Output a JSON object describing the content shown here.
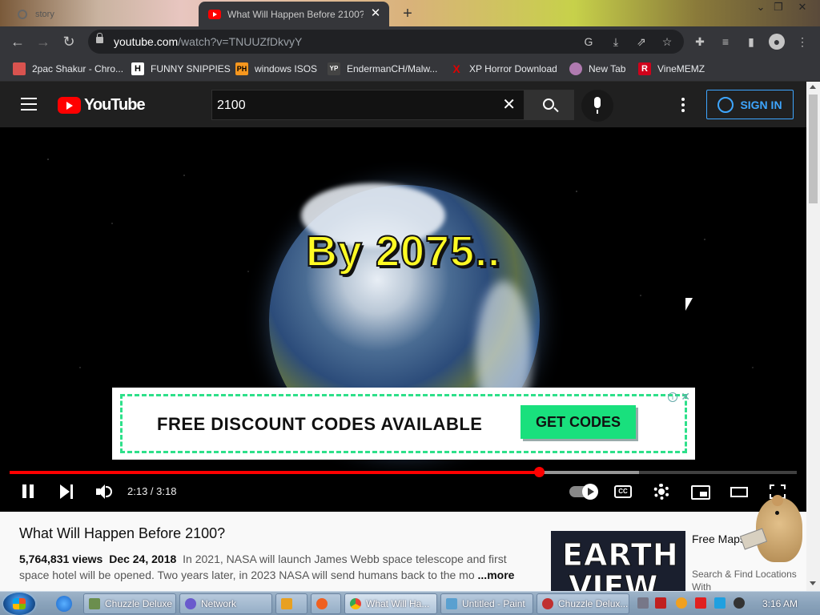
{
  "browser": {
    "prev_tab_label": "story",
    "active_tab_title": "What Will Happen Before 2100?",
    "url_host": "youtube.com",
    "url_path": "/watch?v=TNUUZfDkvyY",
    "new_tab_symbol": "+",
    "close_symbol": "✕"
  },
  "bookmarks": [
    {
      "label": "2pac Shakur - Chro...",
      "icon": "paint-icon",
      "badge": "",
      "color": "#d9534f"
    },
    {
      "label": "FUNNY SNIPPIES",
      "icon": "h-icon",
      "badge": "H",
      "color": "#ffffff"
    },
    {
      "label": "windows ISOS",
      "icon": "ph-icon",
      "badge": "PH",
      "color": "#f7971e"
    },
    {
      "label": "EndermanCH/Malw...",
      "icon": "yp-icon",
      "badge": "YP",
      "color": "#444444"
    },
    {
      "label": "XP Horror Download",
      "icon": "x-icon",
      "badge": "X",
      "color": "#e00000"
    },
    {
      "label": "New Tab",
      "icon": "globe-icon",
      "badge": "",
      "color": "#b07ab0"
    },
    {
      "label": "VineMEMZ",
      "icon": "r-icon",
      "badge": "R",
      "color": "#d0021b"
    }
  ],
  "youtube": {
    "logo_text": "YouTube",
    "search_query": "2100",
    "sign_in_label": "SIGN IN",
    "accent": "#3ea6ff",
    "brand_red": "#ff0000"
  },
  "player": {
    "caption": "By 2075..",
    "ad_headline": "FREE DISCOUNT CODES AVAILABLE",
    "ad_cta": "GET CODES",
    "ad_info": "i",
    "ad_close": "✕",
    "cc_label": "CC",
    "current_time": "2:13",
    "duration": "3:18",
    "time_display": "2:13 / 3:18",
    "played_fraction": 0.672,
    "buffered_fraction": 0.8
  },
  "video": {
    "title": "What Will Happen Before 2100?",
    "views": "5,764,831 views",
    "date": "Dec 24, 2018",
    "description": "In 2021, NASA will launch James Webb space telescope and first space hotel will be opened. Two years later, in 2023 NASA will send humans back to the mo",
    "more_label": "...more"
  },
  "recommended": {
    "thumb_line1": "EARTH",
    "thumb_line2": "VIEW",
    "title": "Free Maps Browser...",
    "channel": "Search & Find Locations With"
  },
  "taskbar": {
    "tasks": [
      {
        "label": "Chuzzle Deluxe",
        "icon": "chuzzle-icon",
        "color": "#6b8e4e"
      },
      {
        "label": "Network",
        "icon": "network-icon",
        "color": "#6a5acd"
      },
      {
        "label": "",
        "icon": "media-player-icon",
        "color": "#e8a020"
      },
      {
        "label": "",
        "icon": "wmp-icon",
        "color": "#f06020"
      },
      {
        "label": "What Will Ha...",
        "icon": "chrome-icon",
        "color": "#4285f4"
      },
      {
        "label": "Untitled - Paint",
        "icon": "paint-icon",
        "color": "#5aa0d0"
      },
      {
        "label": "Chuzzle Delux...",
        "icon": "chuzzle-icon",
        "color": "#c03030"
      }
    ],
    "clock": "3:16 AM"
  }
}
